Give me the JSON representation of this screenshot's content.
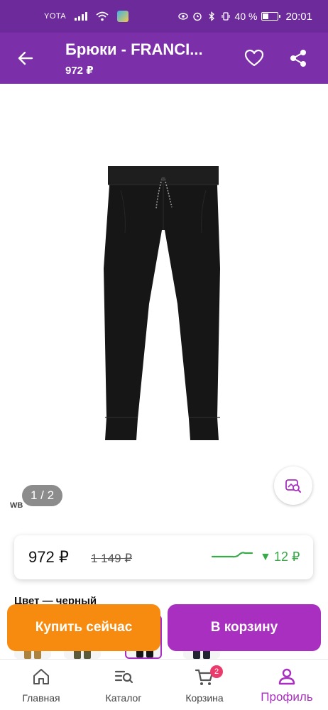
{
  "status_bar": {
    "carrier": "YOTA",
    "battery_text": "40 %",
    "battery_level": 0.4,
    "time": "20:01"
  },
  "header": {
    "title": "Брюки - FRANCI...",
    "price": "972 ₽",
    "back_icon": "arrow-left-icon",
    "favorite_icon": "heart-outline-icon",
    "share_icon": "share-icon"
  },
  "gallery": {
    "page_indicator": "1 / 2",
    "watermark": "WB",
    "search_icon": "image-search-icon"
  },
  "price_card": {
    "current_price": "972 ₽",
    "old_price": "1 149 ₽",
    "price_change": "12 ₽",
    "change_arrow": "▼",
    "accent_color": "#3aa94a"
  },
  "color_section": {
    "label": "Цвет — черный"
  },
  "actions": {
    "buy_now": "Купить сейчас",
    "add_to_cart": "В корзину",
    "buy_color": "#f68b0f",
    "cart_color": "#a92fc0"
  },
  "bottom_nav": {
    "items": [
      {
        "label": "Главная",
        "icon": "home-icon"
      },
      {
        "label": "Каталог",
        "icon": "catalog-search-icon"
      },
      {
        "label": "Корзина",
        "icon": "cart-icon",
        "badge": "2"
      },
      {
        "label": "Профиль",
        "icon": "profile-icon",
        "active": true
      }
    ]
  }
}
